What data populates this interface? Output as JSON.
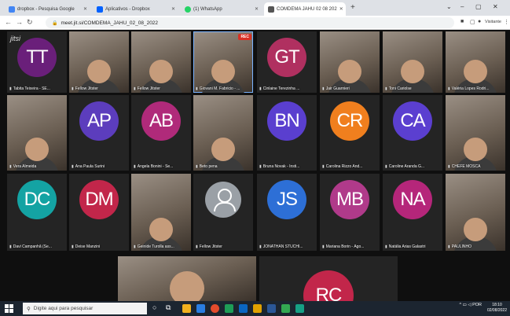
{
  "browser": {
    "tabs": [
      {
        "title": "dropbox - Pesquisa Google",
        "favicon_color": "#4285f4"
      },
      {
        "title": "Aplicativos - Dropbox",
        "favicon_color": "#0061fe"
      },
      {
        "title": "(1) WhatsApp",
        "favicon_color": "#25d366"
      },
      {
        "title": "COMDEMA JAHU 02 08 202",
        "favicon_color": "#555555"
      }
    ],
    "active_tab": 3,
    "new_tab_glyph": "+",
    "window_controls": [
      "⌄",
      "–",
      "▢",
      "✕"
    ],
    "address": "meet.jit.si/COMDEMA_JAHU_02_08_2022",
    "profile_label": "Visitante"
  },
  "meeting": {
    "recording_badge": "REC",
    "logo_text": "jitsi",
    "participants": [
      {
        "name": "Tabita Teixeira - SE...",
        "initials": "TT",
        "color": "#6a1f7a",
        "type": "avatar"
      },
      {
        "name": "Fellow Jitster",
        "type": "video"
      },
      {
        "name": "Fellow Jitster",
        "type": "video"
      },
      {
        "name": "Giovani M. Fabricio - ...",
        "type": "video",
        "active": true
      },
      {
        "name": "Cinlaine Terezinha ...",
        "initials": "GT",
        "color": "#b03060",
        "type": "avatar"
      },
      {
        "name": "Jair Guarnieri",
        "type": "video"
      },
      {
        "name": "Toni Cariolse",
        "type": "video"
      },
      {
        "name": "Valéria Lopes Rodri...",
        "type": "video"
      },
      {
        "name": "Vera Almeida",
        "type": "video"
      },
      {
        "name": "Ana Paula Surini",
        "initials": "AP",
        "color": "#5c3dbd",
        "type": "avatar"
      },
      {
        "name": "Angela Bonini - Se...",
        "initials": "AB",
        "color": "#b02a7a",
        "type": "avatar"
      },
      {
        "name": "Beto pena",
        "type": "video"
      },
      {
        "name": "Bruna Novak - Insti...",
        "initials": "BN",
        "color": "#5a3fcf",
        "type": "avatar"
      },
      {
        "name": "Carolina Rizzo And...",
        "initials": "CR",
        "color": "#f07f1e",
        "type": "avatar"
      },
      {
        "name": "Caroline Aranda G...",
        "initials": "CA",
        "color": "#5b3fd0",
        "type": "avatar"
      },
      {
        "name": "CHEFE MOSCA",
        "type": "video"
      },
      {
        "name": "Davi Campanhã (Se...",
        "initials": "DC",
        "color": "#14a3a3",
        "type": "avatar"
      },
      {
        "name": "Deise Manzini",
        "initials": "DM",
        "color": "#c2264a",
        "type": "avatar"
      },
      {
        "name": "Geinide Turolla ass...",
        "type": "video"
      },
      {
        "name": "Fellow Jitster",
        "type": "placeholder"
      },
      {
        "name": "JONATHAN STUCHI...",
        "initials": "JS",
        "color": "#2d6fd6",
        "type": "avatar"
      },
      {
        "name": "Mariana Borin - Ágo...",
        "initials": "MB",
        "color": "#b03a8a",
        "type": "avatar"
      },
      {
        "name": "Natália Arias Galastri",
        "initials": "NA",
        "color": "#b5267a",
        "type": "avatar"
      },
      {
        "name": "PAULINHO",
        "type": "video"
      }
    ],
    "bottom_row": [
      {
        "type": "video"
      },
      {
        "initials": "RC",
        "color": "#c2264a",
        "type": "avatar"
      }
    ]
  },
  "taskbar": {
    "search_placeholder": "Digite aqui para pesquisar",
    "language": "POR",
    "time": "18:10",
    "date": "02/08/2022",
    "app_colors": [
      "#f2b01e",
      "#2a7de1",
      "#e34b2c",
      "#1e9d57",
      "#0a66c2",
      "#e0a100",
      "#2b5797",
      "#33a852",
      "#16a085"
    ]
  }
}
